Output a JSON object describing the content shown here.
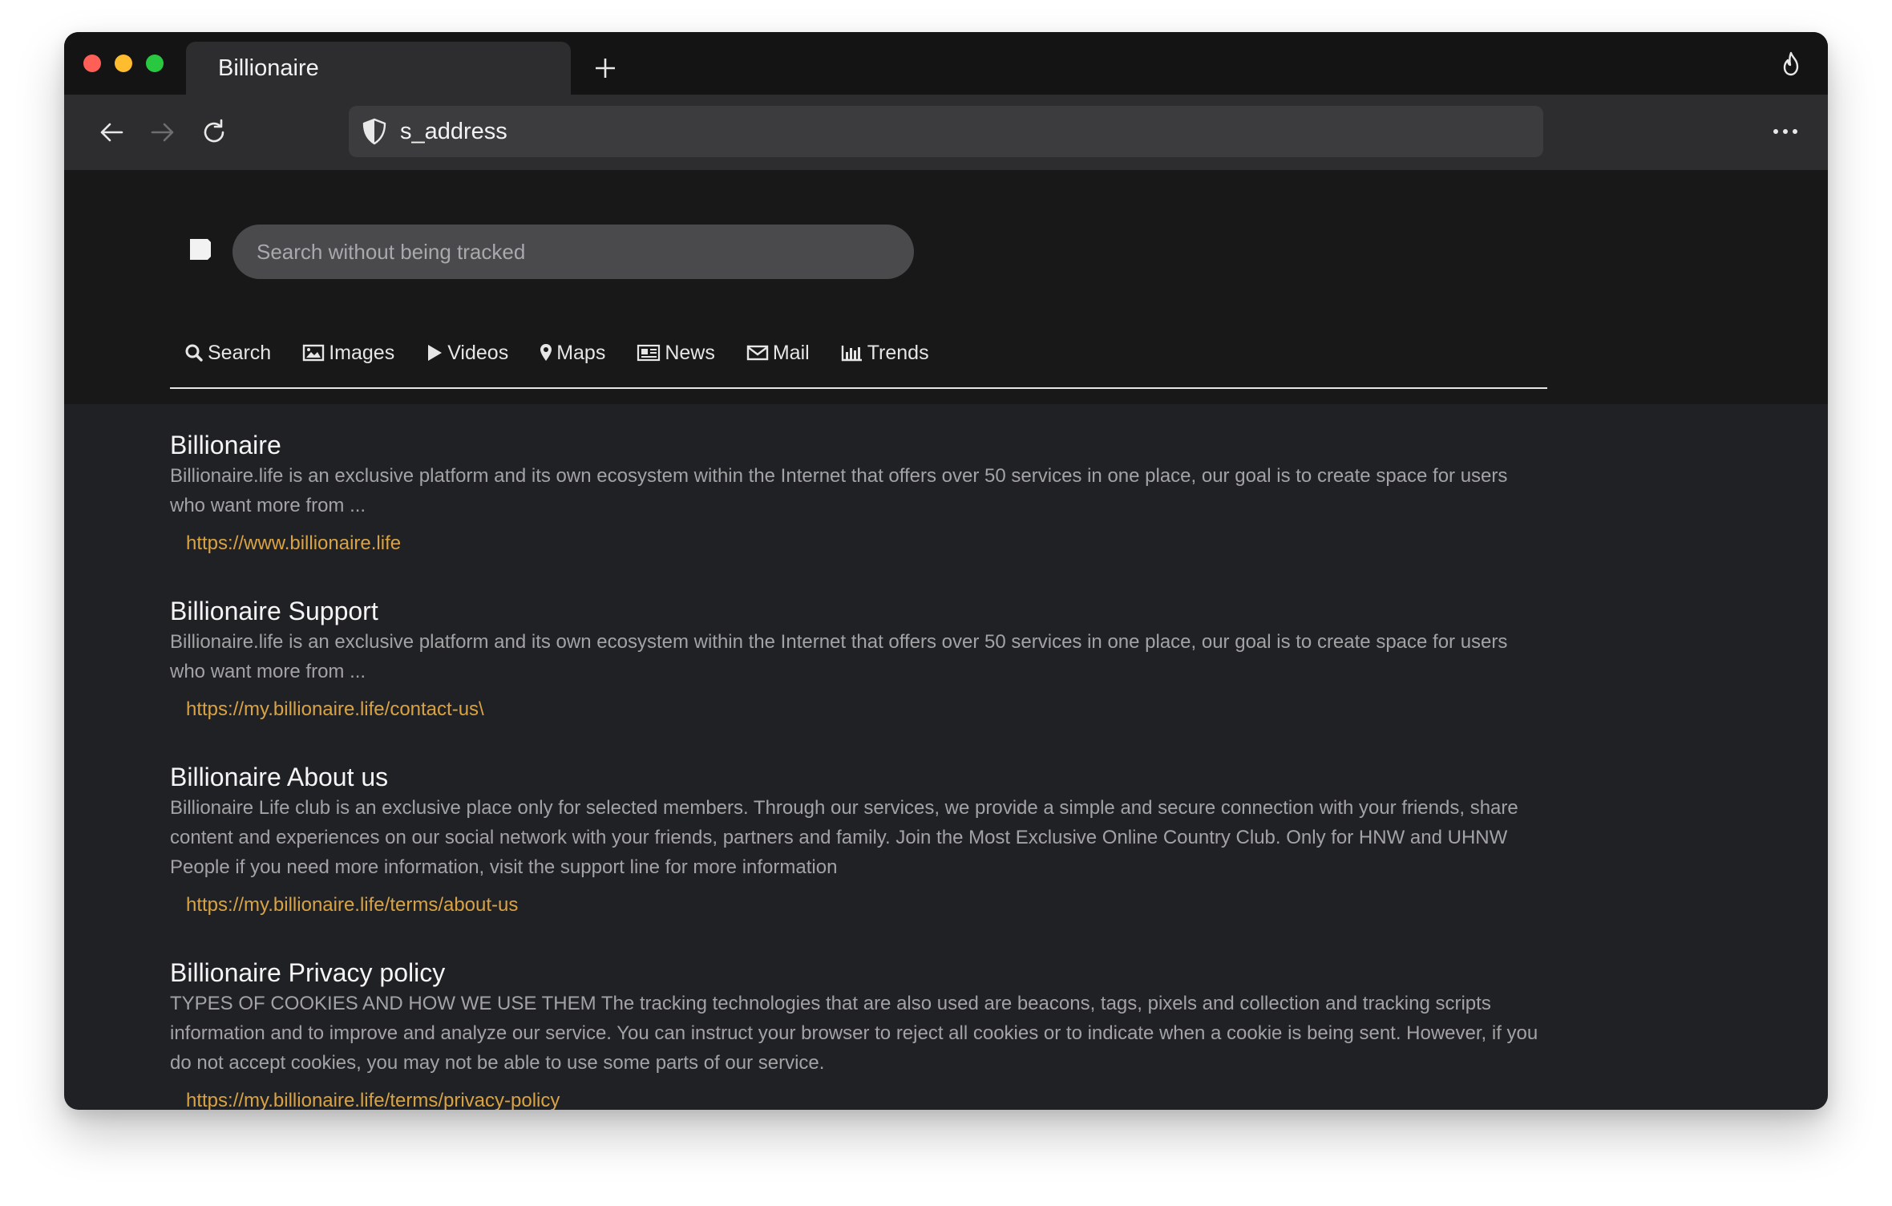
{
  "browser": {
    "tab_title": "Billionaire",
    "address": "s_address"
  },
  "search": {
    "placeholder": "Search without being tracked",
    "tabs": [
      {
        "label": "Search",
        "icon": "search-icon"
      },
      {
        "label": "Images",
        "icon": "image-icon"
      },
      {
        "label": "Videos",
        "icon": "play-icon"
      },
      {
        "label": "Maps",
        "icon": "map-pin-icon"
      },
      {
        "label": "News",
        "icon": "newspaper-icon"
      },
      {
        "label": "Mail",
        "icon": "mail-icon"
      },
      {
        "label": "Trends",
        "icon": "bar-chart-icon"
      }
    ]
  },
  "results": [
    {
      "title": "Billionaire",
      "desc": "Billionaire.life is an exclusive platform and its own ecosystem within the Internet that offers over 50 services in one place, our goal is to create space for users who want more from ...",
      "url": "https://www.billionaire.life"
    },
    {
      "title": "Billionaire Support",
      "desc": "Billionaire.life is an exclusive platform and its own ecosystem within the Internet that offers over 50 services in one place, our goal is to create space for users who want more from ...",
      "url": "https://my.billionaire.life/contact-us\\"
    },
    {
      "title": "Billionaire About us",
      "desc": "Billionaire Life club is an exclusive place only for selected members. Through our services, we provide a simple and secure connection with your friends, share content and experiences on our social network with your friends, partners and family. Join the Most Exclusive Online Country Club. Only for HNW and UHNW People if you need more information, visit the support line for more information",
      "url": "https://my.billionaire.life/terms/about-us"
    },
    {
      "title": "Billionaire Privacy policy",
      "desc": "TYPES OF COOKIES AND HOW WE USE THEM The tracking technologies that are also used are beacons, tags, pixels and collection and tracking scripts information and to improve and analyze our service. You can instruct your browser to reject all cookies or to indicate when a cookie is being sent. However, if you do not accept cookies, you may not be able to use some parts of our service.",
      "url": "https://my.billionaire.life/terms/privacy-policy"
    }
  ]
}
